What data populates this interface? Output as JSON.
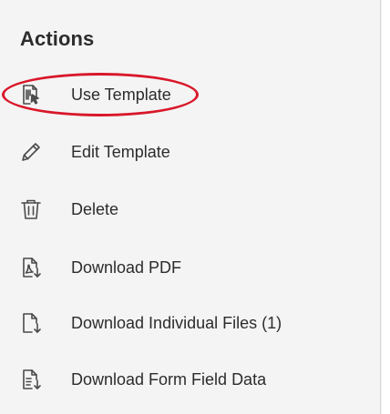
{
  "panel": {
    "heading": "Actions",
    "items": [
      {
        "label": "Use Template",
        "icon": "use-template-icon"
      },
      {
        "label": "Edit Template",
        "icon": "pencil-icon"
      },
      {
        "label": "Delete",
        "icon": "trash-icon"
      },
      {
        "label": "Download PDF",
        "icon": "pdf-download-icon"
      },
      {
        "label": "Download Individual Files (1)",
        "icon": "file-download-icon"
      },
      {
        "label": "Download Form Field Data",
        "icon": "form-data-download-icon"
      }
    ]
  },
  "colors": {
    "background": "#f4f4f4",
    "text": "#2c2c2c",
    "icon": "#4b4b4b",
    "annotation": "#d9172a"
  }
}
